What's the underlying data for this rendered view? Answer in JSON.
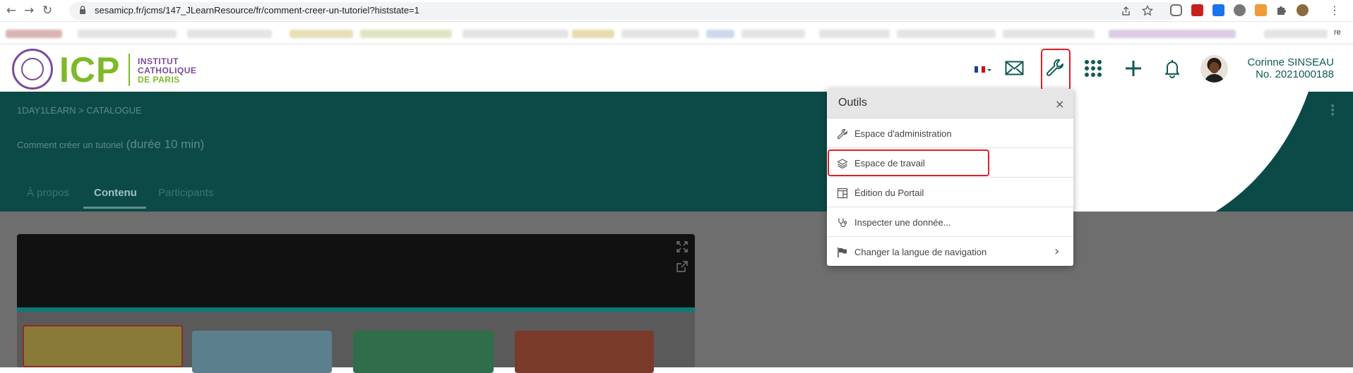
{
  "browser": {
    "url": "sesamicp.fr/jcms/147_JLearnResource/fr/comment-creer-un-tutoriel?histstate=1",
    "bookmark_fragment": "re"
  },
  "header": {
    "logo_text": "ICP",
    "logo_sub": [
      "INSTITUT",
      "CATHOLIQUE",
      "DE PARIS"
    ],
    "user_name": "Corinne SINSEAU",
    "user_number": "No. 2021000188",
    "accent_color": "#0f5a55",
    "brand_green": "#7db928",
    "brand_purple": "#7b4a9c"
  },
  "page": {
    "breadcrumb": "1DAY1LEARN > CATALOGUE",
    "title": "Comment créer un tutoriel",
    "duration": "(durée 10 min)",
    "tabs": [
      "À propos",
      "Contenu",
      "Participants"
    ],
    "active_tab": "Contenu"
  },
  "popover": {
    "title": "Outils",
    "close_icon": "×",
    "items": [
      {
        "label": "Espace d'administration",
        "icon": "wrench-icon"
      },
      {
        "label": "Espace de travail",
        "icon": "layers-icon"
      },
      {
        "label": "Édition du Portail",
        "icon": "layout-icon"
      },
      {
        "label": "Inspecter une donnée...",
        "icon": "stethoscope-icon"
      },
      {
        "label": "Changer la langue de navigation",
        "icon": "flag-icon",
        "chevron": "›"
      }
    ]
  }
}
